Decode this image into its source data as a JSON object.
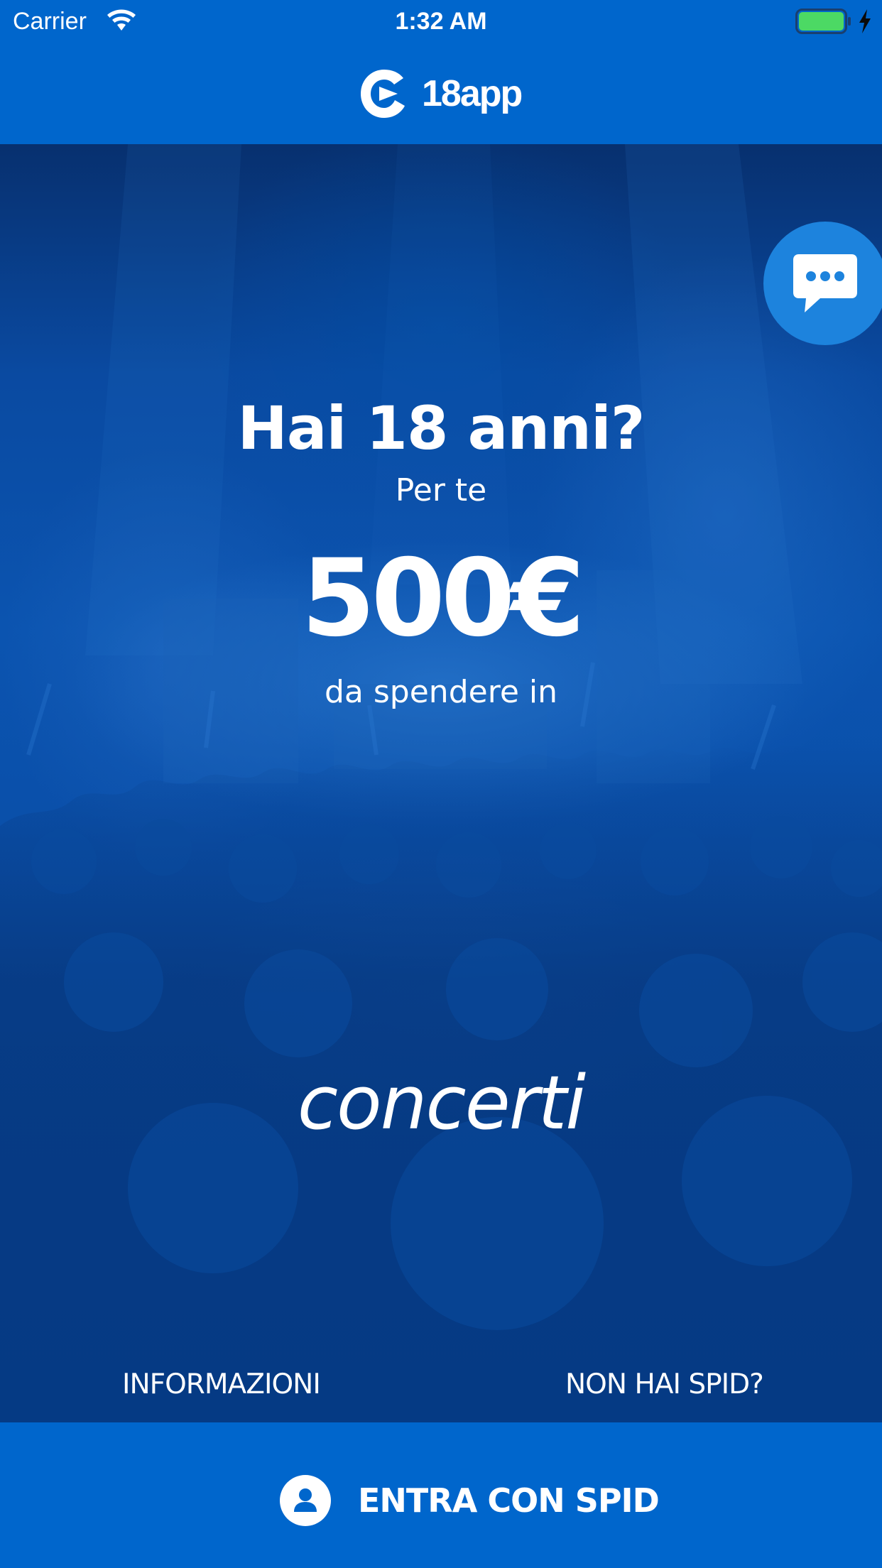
{
  "status_bar": {
    "carrier": "Carrier",
    "time": "1:32 AM",
    "battery_color": "#4CD964"
  },
  "header": {
    "logo_text": "18app",
    "logo_icon": "18app-logo-icon"
  },
  "hero": {
    "headline": "Hai 18 anni?",
    "subline": "Per te",
    "amount": "500€",
    "spend_text": "da spendere in",
    "category": "concerti",
    "background": "concert-crowd-photo"
  },
  "chat": {
    "icon": "chat-bubble-icon"
  },
  "links": {
    "info": "INFORMAZIONI",
    "no_spid": "NON HAI SPID?"
  },
  "footer": {
    "spid_button_label": "ENTRA CON SPID",
    "icon": "user-icon"
  },
  "colors": {
    "primary": "#0066CC",
    "chat_button": "#1D83DD",
    "text": "#FFFFFF"
  }
}
